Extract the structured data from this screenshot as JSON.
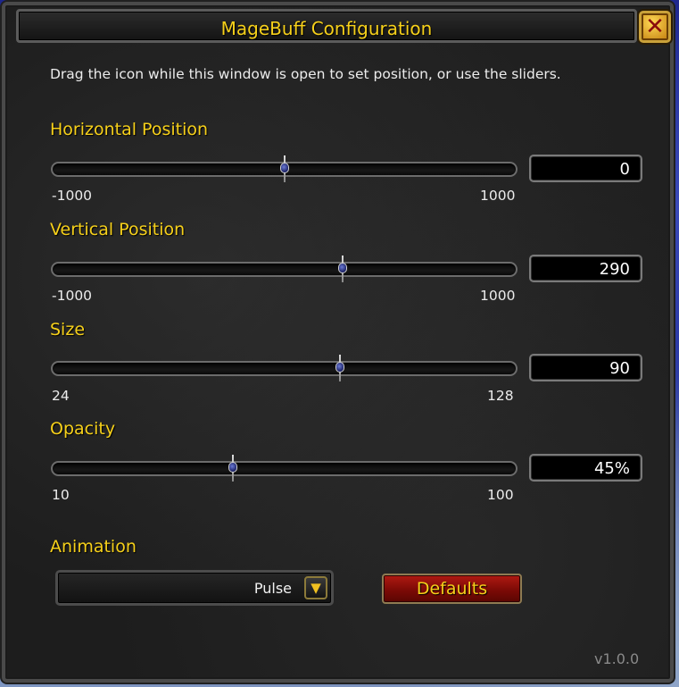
{
  "window": {
    "title": "MageBuff Configuration",
    "close_icon": "close-x-icon",
    "description": "Drag the icon while this window is open to set position, or use the sliders."
  },
  "sliders": [
    {
      "label": "Horizontal Position",
      "min": "-1000",
      "max": "1000",
      "value": "0",
      "fraction": 0.5
    },
    {
      "label": "Vertical Position",
      "min": "-1000",
      "max": "1000",
      "value": "290",
      "fraction": 0.627
    },
    {
      "label": "Size",
      "min": "24",
      "max": "128",
      "value": "90",
      "fraction": 0.62
    },
    {
      "label": "Opacity",
      "min": "10",
      "max": "100",
      "value": "45%",
      "fraction": 0.39
    }
  ],
  "animation": {
    "label": "Animation",
    "selected": "Pulse",
    "arrow_icon": "chevron-down-icon"
  },
  "defaults_button": "Defaults",
  "version": "v1.0.0",
  "colors": {
    "title_gold": "#f6d01a",
    "button_red": "#9b1009",
    "panel_bg": "#1d1d1d"
  }
}
